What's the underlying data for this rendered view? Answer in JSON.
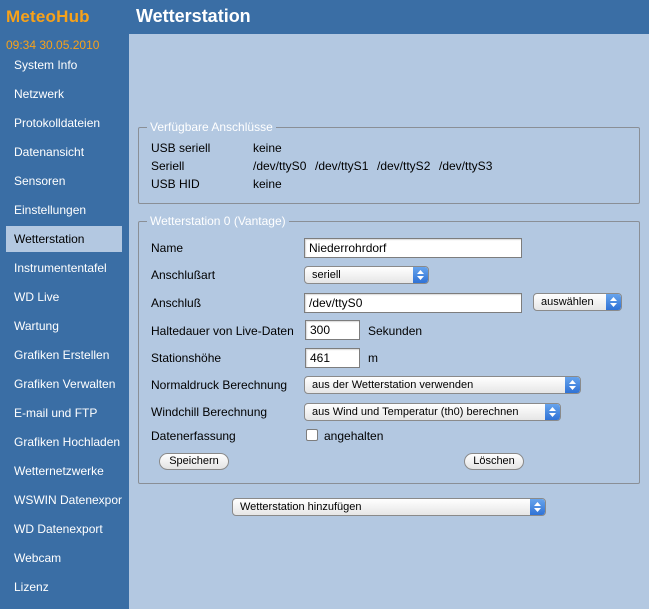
{
  "app": {
    "name": "MeteoHub",
    "page_title": "Wetterstation",
    "datetime": "09:34  30.05.2010"
  },
  "sidebar": {
    "items": [
      {
        "label": "System Info"
      },
      {
        "label": "Netzwerk"
      },
      {
        "label": "Protokolldateien"
      },
      {
        "label": "Datenansicht"
      },
      {
        "label": "Sensoren"
      },
      {
        "label": "Einstellungen"
      },
      {
        "label": "Wetterstation",
        "active": true
      },
      {
        "label": "Instrumententafel"
      },
      {
        "label": "WD Live"
      },
      {
        "label": "Wartung"
      },
      {
        "label": "Grafiken Erstellen"
      },
      {
        "label": "Grafiken Verwalten"
      },
      {
        "label": "E-mail und FTP"
      },
      {
        "label": "Grafiken Hochladen"
      },
      {
        "label": "Wetternetzwerke"
      },
      {
        "label": "WSWIN Datenexport"
      },
      {
        "label": "WD Datenexport"
      },
      {
        "label": "Webcam"
      },
      {
        "label": "Lizenz"
      }
    ]
  },
  "ports": {
    "legend": "Verfügbare Anschlüsse",
    "usb_serial_label": "USB seriell",
    "usb_serial_value": "keine",
    "serial_label": "Seriell",
    "serial_ports": [
      "/dev/ttyS0",
      "/dev/ttyS1",
      "/dev/ttyS2",
      "/dev/ttyS3"
    ],
    "usb_hid_label": "USB HID",
    "usb_hid_value": "keine"
  },
  "station": {
    "legend": "Wetterstation 0 (Vantage)",
    "name_label": "Name",
    "name_value": "Niederrohrdorf",
    "connection_type_label": "Anschlußart",
    "connection_type_value": "seriell",
    "port_label": "Anschluß",
    "port_value": "/dev/ttyS0",
    "choose_button": "auswählen",
    "live_hold_label": "Haltedauer von Live-Daten",
    "live_hold_value": "300",
    "live_hold_unit": "Sekunden",
    "altitude_label": "Stationshöhe",
    "altitude_value": "461",
    "altitude_unit": "m",
    "pressure_label": "Normaldruck Berechnung",
    "pressure_value": "aus der Wetterstation verwenden",
    "windchill_label": "Windchill Berechnung",
    "windchill_value": "aus Wind und Temperatur (th0) berechnen",
    "capture_label": "Datenerfassung",
    "capture_checkbox_label": "angehalten",
    "save_button": "Speichern",
    "delete_button": "Löschen"
  },
  "add_station": {
    "label": "Wetterstation hinzufügen"
  },
  "colors": {
    "sidebar_bg": "#3a6ea5",
    "content_bg": "#b3c8e1",
    "brand": "#f7a21a",
    "select_arrow": "#2c6fd4"
  }
}
